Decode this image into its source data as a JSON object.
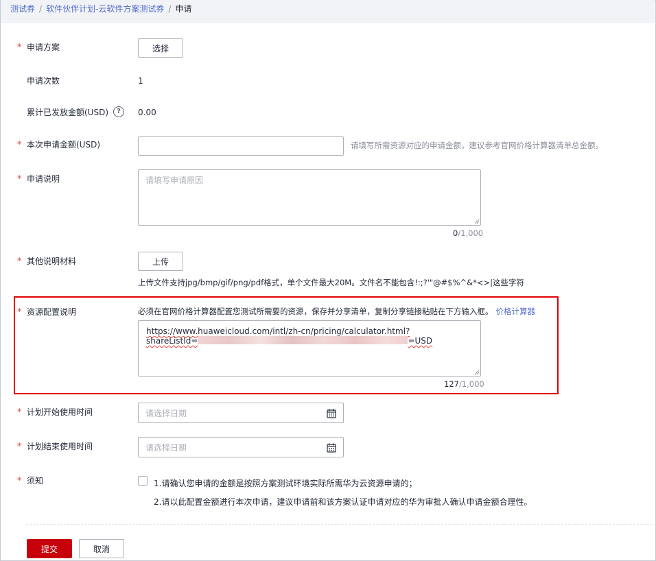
{
  "breadcrumb": {
    "items": [
      "测试券",
      "软件伙伴计划-云软件方案测试券"
    ],
    "separator": "/",
    "current": "申请"
  },
  "form": {
    "required_mark": "*",
    "plan": {
      "label": "申请方案",
      "button": "选择"
    },
    "count": {
      "label": "申请次数",
      "value": "1"
    },
    "issued": {
      "label": "累计已发放金额(USD)",
      "help_icon": "?",
      "value": "0.00"
    },
    "amount": {
      "label": "本次申请金额(USD)",
      "value": "",
      "hint": "请填写所需资源对应的申请金额，建议参考官网价格计算器清单总金额。"
    },
    "reason": {
      "label": "申请说明",
      "placeholder": "请填写申请原因",
      "count": "0",
      "max": "/1,000"
    },
    "materials": {
      "label": "其他说明材料",
      "button": "上传",
      "hint": "上传文件支持jpg/bmp/gif/png/pdf格式，单个文件最大20M。文件名不能包含!:;?'\"@#$%^&*<>|这些字符"
    },
    "resource": {
      "label": "资源配置说明",
      "instruction": "必须在官网价格计算器配置您测试所需要的资源，保存并分享清单，复制分享链接粘贴在下方输入框。",
      "link": "价格计算器",
      "url_line1": "https://www.huaweicloud.com/intl/zh-cn/pricing/calculator.html?",
      "url_line2_prefix": "shareListId=",
      "url_line2_suffix": "=USD",
      "count": "127",
      "max": "/1,000"
    },
    "start_date": {
      "label": "计划开始使用时间",
      "placeholder": "请选择日期"
    },
    "end_date": {
      "label": "计划结束使用时间",
      "placeholder": "请选择日期"
    },
    "notice": {
      "label": "须知",
      "line1": "1.请确认您申请的金额是按照方案测试环境实际所需华为云资源申请的；",
      "line2": "2.请以此配置金额进行本次申请，建议申请前和该方案认证申请对应的华为审批人确认申请金额合理性。"
    }
  },
  "actions": {
    "submit": "提交",
    "cancel": "取消"
  },
  "colors": {
    "accent": "#c7000b",
    "link": "#526ecc",
    "required": "#e8433e",
    "highlight_border": "#e00000"
  }
}
